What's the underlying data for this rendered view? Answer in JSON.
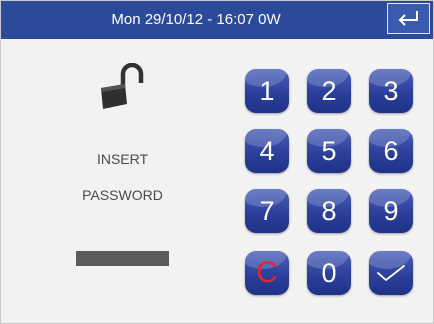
{
  "header": {
    "status_text": "Mon 29/10/12 - 16:07   0W",
    "back_icon": "return-arrow-icon"
  },
  "lock": {
    "icon": "unlocked-padlock-icon"
  },
  "prompt": {
    "line1": "INSERT",
    "line2": "PASSWORD"
  },
  "keypad": {
    "keys": [
      "1",
      "2",
      "3",
      "4",
      "5",
      "6",
      "7",
      "8",
      "9",
      "C",
      "0"
    ],
    "confirm_icon": "checkmark-icon"
  },
  "colors": {
    "header_bg": "#2c4a9a",
    "key_bg": "#2b3f9c",
    "clear_key_text": "#e8232e",
    "page_bg": "#f2f2f2"
  }
}
